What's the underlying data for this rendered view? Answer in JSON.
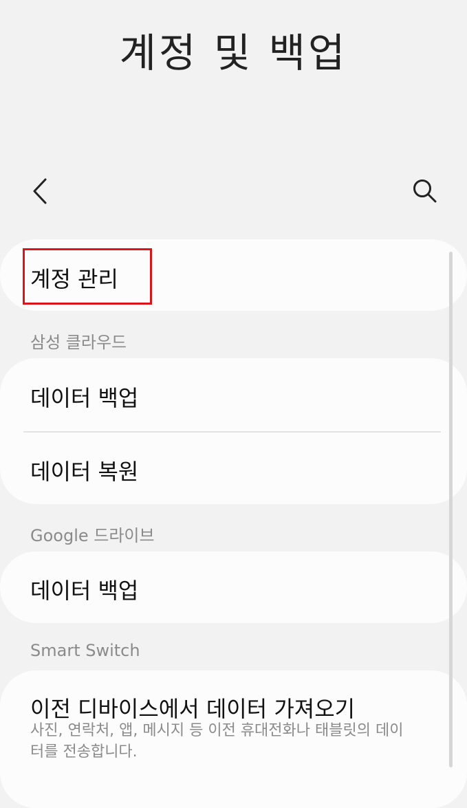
{
  "header": {
    "title": "계정 및 백업"
  },
  "toolbar": {
    "back_icon": "chevron-left-icon",
    "search_icon": "search-icon"
  },
  "account": {
    "manage_label": "계정 관리"
  },
  "samsung_cloud": {
    "header": "삼성 클라우드",
    "backup_label": "데이터 백업",
    "restore_label": "데이터 복원"
  },
  "google_drive": {
    "header": "Google 드라이브",
    "backup_label": "데이터 백업"
  },
  "smart_switch": {
    "header": "Smart Switch",
    "import_label": "이전 디바이스에서 데이터 가져오기",
    "import_description": "사진, 연락처, 앱, 메시지 등 이전 휴대전화나 태블릿의 데이터를 전송합니다."
  },
  "colors": {
    "background": "#f2f2f2",
    "card": "#fcfcfc",
    "highlight": "#d9141b",
    "secondary_text": "#8a8a8a"
  }
}
